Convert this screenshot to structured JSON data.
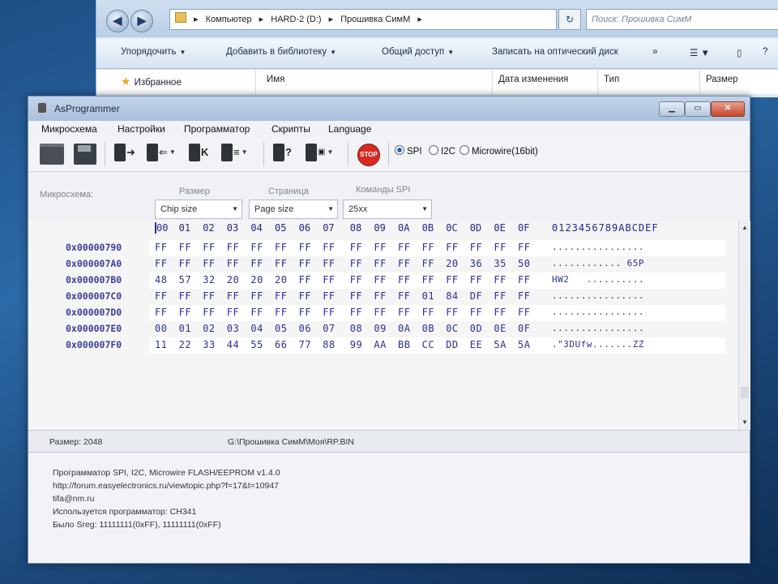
{
  "explorer": {
    "address": [
      "Компьютер",
      "HARD-2 (D:)",
      "Прошивка СимМ"
    ],
    "search_placeholder": "Поиск: Прошивка СимМ",
    "toolbar": [
      "Упорядочить",
      "Добавить в библиотеку",
      "Общий доступ",
      "Записать на оптический диск",
      "»"
    ],
    "favorites": "Избранное",
    "columns": [
      "Имя",
      "Дата изменения",
      "Тип",
      "Размер"
    ]
  },
  "app": {
    "title": "AsProgrammer",
    "menu": [
      "Микросхема",
      "Настройки",
      "Программатор",
      "Скрипты",
      "Language"
    ],
    "protocols": [
      "SPI",
      "I2C",
      "Microwire(16bit)"
    ],
    "selected_protocol": "SPI",
    "stop_label": "STOP",
    "chip_label": "Микросхема:",
    "params": {
      "size_label": "Размер",
      "size_value": "Chip size",
      "page_label": "Страница",
      "page_value": "Page size",
      "cmd_label": "Команды SPI",
      "cmd_value": "25xx"
    },
    "hex": {
      "header": [
        "00",
        "01",
        "02",
        "03",
        "04",
        "05",
        "06",
        "07",
        "08",
        "09",
        "0A",
        "0B",
        "0C",
        "0D",
        "0E",
        "0F"
      ],
      "ascii_header": "0123456789ABCDEF",
      "rows": [
        {
          "addr": "0x00000790",
          "bytes": [
            "FF",
            "FF",
            "FF",
            "FF",
            "FF",
            "FF",
            "FF",
            "FF",
            "FF",
            "FF",
            "FF",
            "FF",
            "FF",
            "FF",
            "FF",
            "FF"
          ],
          "ascii": "................"
        },
        {
          "addr": "0x000007A0",
          "bytes": [
            "FF",
            "FF",
            "FF",
            "FF",
            "FF",
            "FF",
            "FF",
            "FF",
            "FF",
            "FF",
            "FF",
            "FF",
            "20",
            "36",
            "35",
            "50"
          ],
          "ascii": "............ 65P"
        },
        {
          "addr": "0x000007B0",
          "bytes": [
            "48",
            "57",
            "32",
            "20",
            "20",
            "20",
            "FF",
            "FF",
            "FF",
            "FF",
            "FF",
            "FF",
            "FF",
            "FF",
            "FF",
            "FF"
          ],
          "ascii": "HW2   .........."
        },
        {
          "addr": "0x000007C0",
          "bytes": [
            "FF",
            "FF",
            "FF",
            "FF",
            "FF",
            "FF",
            "FF",
            "FF",
            "FF",
            "FF",
            "FF",
            "01",
            "84",
            "DF",
            "FF",
            "FF"
          ],
          "ascii": "................"
        },
        {
          "addr": "0x000007D0",
          "bytes": [
            "FF",
            "FF",
            "FF",
            "FF",
            "FF",
            "FF",
            "FF",
            "FF",
            "FF",
            "FF",
            "FF",
            "FF",
            "FF",
            "FF",
            "FF",
            "FF"
          ],
          "ascii": "................"
        },
        {
          "addr": "0x000007E0",
          "bytes": [
            "00",
            "01",
            "02",
            "03",
            "04",
            "05",
            "06",
            "07",
            "08",
            "09",
            "0A",
            "0B",
            "0C",
            "0D",
            "0E",
            "0F"
          ],
          "ascii": "................"
        },
        {
          "addr": "0x000007F0",
          "bytes": [
            "11",
            "22",
            "33",
            "44",
            "55",
            "66",
            "77",
            "88",
            "99",
            "AA",
            "BB",
            "CC",
            "DD",
            "EE",
            "5A",
            "5A"
          ],
          "ascii": ".\"3DUfw.......ZZ"
        }
      ]
    },
    "status": {
      "size": "Размер: 2048",
      "path": "G:\\Прошивка СимМ\\Моя\\RP.BIN"
    },
    "log": [
      "Программатор SPI, I2C, Microwire FLASH/EEPROM v1.4.0",
      "http://forum.easyelectronics.ru/viewtopic.php?f=17&t=10947",
      "tifa@nm.ru",
      "Используется программатор: CH341",
      "Было Sreg: 11111111(0xFF), 11111111(0xFF)"
    ]
  }
}
